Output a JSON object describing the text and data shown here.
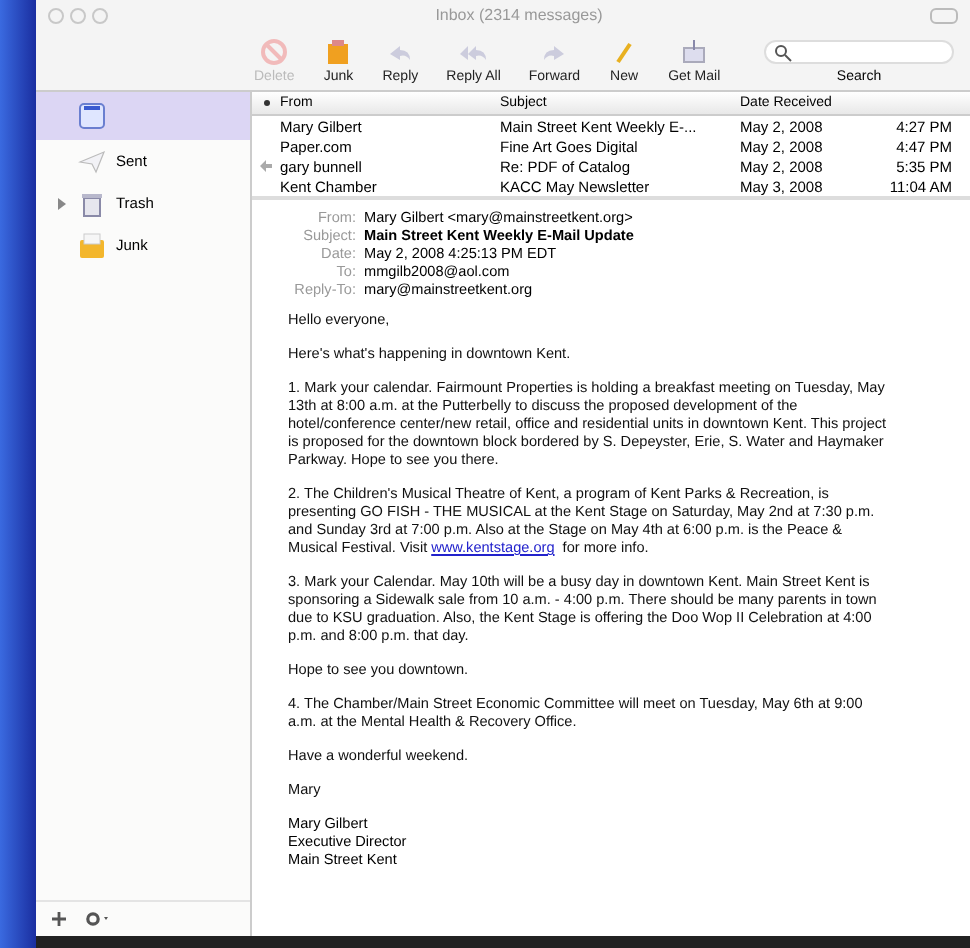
{
  "window": {
    "title": "Inbox (2314 messages)"
  },
  "toolbar": [
    {
      "label": "Delete",
      "kind": "delete",
      "disabled": true
    },
    {
      "label": "Junk",
      "kind": "junk",
      "disabled": false
    },
    {
      "label": "Reply",
      "kind": "reply",
      "disabled": false
    },
    {
      "label": "Reply All",
      "kind": "replyall",
      "disabled": false
    },
    {
      "label": "Forward",
      "kind": "forward",
      "disabled": false
    },
    {
      "label": "New",
      "kind": "new",
      "disabled": false
    },
    {
      "label": "Get Mail",
      "kind": "getmail",
      "disabled": false
    }
  ],
  "search": {
    "label": "Search"
  },
  "sidebar": {
    "items": [
      {
        "kind": "inbox",
        "selected": true
      },
      {
        "label": "Sent",
        "kind": "sent",
        "selected": false
      },
      {
        "label": "Trash",
        "kind": "trash",
        "selected": false,
        "expanded": false
      },
      {
        "label": "Junk",
        "kind": "junk",
        "selected": false
      }
    ]
  },
  "message_list": {
    "columns": [
      "From",
      "Subject",
      "Date Received"
    ],
    "rows": [
      {
        "from": "Mary Gilbert",
        "subject": "Main Street Kent Weekly E-...",
        "date": "May 2, 2008",
        "time": "4:27 PM",
        "replied": false
      },
      {
        "from": "Paper.com",
        "subject": "Fine Art Goes Digital",
        "date": "May 2, 2008",
        "time": "4:47 PM",
        "replied": false
      },
      {
        "from": "gary bunnell",
        "subject": "Re: PDF of Catalog",
        "date": "May 2, 2008",
        "time": "5:35 PM",
        "replied": true
      },
      {
        "from": "Kent Chamber",
        "subject": "KACC May Newsletter",
        "date": "May 3, 2008",
        "time": "11:04 AM",
        "replied": false
      }
    ]
  },
  "message": {
    "headers": [
      {
        "name": "From:",
        "value": "Mary Gilbert <mary@mainstreetkent.org>",
        "kind": "plain"
      },
      {
        "name": "Subject:",
        "value": "Main Street Kent Weekly E-Mail Update",
        "kind": "subject"
      },
      {
        "name": "Date:",
        "value": "May 2, 2008 4:25:13 PM EDT",
        "kind": "plain"
      },
      {
        "name": "To:",
        "value": "mmgilb2008@aol.com",
        "kind": "plain"
      },
      {
        "name": "Reply-To:",
        "value": "mary@mainstreetkent.org",
        "kind": "plain"
      }
    ],
    "paragraphs": [
      {
        "text": "Hello everyone,"
      },
      {
        "text": "Here's what's happening in downtown Kent."
      },
      {
        "text": "1.  Mark your calendar.  Fairmount Properties is holding a breakfast meeting on Tuesday, May 13th at 8:00 a.m. at the Putterbelly to discuss the proposed development of the hotel/conference center/new retail, office and residential units in downtown Kent.  This project is proposed for the downtown block bordered by S. Depeyster, Erie, S. Water and Haymaker Parkway.  Hope to see you there."
      },
      {
        "text": "2.  The Children's Musical Theatre of Kent, a program of Kent Parks & Recreation, is presenting GO FISH - THE MUSICAL at the Kent Stage on Saturday, May 2nd at 7:30 p.m. and Sunday 3rd at 7:00 p.m.  Also at the Stage on May 4th at 6:00 p.m. is the Peace & Musical Festival.  Visit",
        "link": "www.kentstage.org",
        "after": "for more info."
      },
      {
        "text": "3.  Mark your Calendar.  May 10th will be a busy day in downtown Kent.  Main Street Kent is sponsoring a Sidewalk sale from 10 a.m. - 4:00 p.m.  There should be many parents in town due to KSU graduation.  Also, the Kent Stage is offering the Doo Wop II Celebration at 4:00 p.m. and 8:00 p.m. that day."
      },
      {
        "text": "Hope to see you downtown."
      },
      {
        "text": "4.  The Chamber/Main Street Economic Committee will meet on Tuesday, May 6th at 9:00 a.m. at the Mental Health & Recovery Office."
      },
      {
        "text": "Have a wonderful weekend."
      },
      {
        "text": "Mary"
      }
    ],
    "signature": [
      "Mary Gilbert",
      "Executive Director",
      "Main Street Kent"
    ]
  }
}
